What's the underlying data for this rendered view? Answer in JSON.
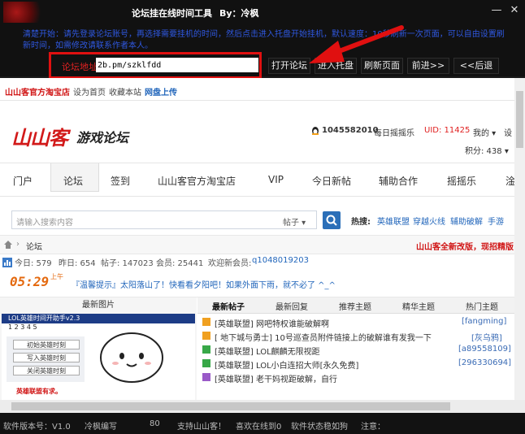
{
  "window": {
    "title": "论坛挂在线时间工具",
    "author": "By：冷枫",
    "min_glyph": "—",
    "close_glyph": "✕"
  },
  "notice": "清楚开始：请先登录论坛账号，再选择需要挂机的时间，然后点击进入托盘开始挂机，默认速度：10秒刷新一次页面，可以自由设置刷新时间，如需修改请联系作者本人。",
  "address": {
    "label": "论坛地址",
    "value": "2b.pm/szklfdd"
  },
  "nav_buttons": {
    "open": "打开论坛",
    "tray": "进入托盘",
    "refresh": "刷新页面",
    "forward": "前进>>",
    "back": "<<后退"
  },
  "site": {
    "topbar": {
      "shop": "山山客官方淘宝店",
      "home": "设为首页",
      "fav": "收藏本站",
      "cloud": "网盘上传"
    },
    "logo_text": "山山客",
    "logo_sub": "游戏论坛",
    "user": {
      "qq": "1045582010",
      "shake": "每日摇摇乐",
      "uid": "UID: 11425",
      "mine": "我的 ▾",
      "settings": "设",
      "points": "积分: 438 ▾"
    },
    "mainnav": [
      "门户",
      "论坛",
      "签到",
      "山山客官方淘宝店",
      "VIP",
      "今日新帖",
      "辅助合作",
      "摇摇乐",
      "淦"
    ],
    "search": {
      "placeholder": "请输入搜索内容",
      "type": "帖子 ▾"
    },
    "hot": {
      "label": "热搜:",
      "items": [
        "英雄联盟",
        "穿越火线",
        "辅助破解",
        "手游"
      ]
    },
    "crumb": "论坛",
    "promo": "山山客全新改版，现招精版",
    "stats": {
      "today": "今日: 579",
      "yesterday": "昨日: 654",
      "posts": "帖子: 147023",
      "members": "会员: 25441",
      "newest_label": "欢迎新会员:",
      "newest": "q1048019203"
    },
    "banner": {
      "clock": "05:29",
      "clock_sub": "上午",
      "text": "『温馨提示』太阳落山了！快看看夕阳吧！如果外面下雨，就不必了 ^_^"
    },
    "leftpanel": {
      "title": "最新图片",
      "widget_title": "LOL英雄时间开助手v2.3",
      "btn1": "初始英雄时刻",
      "btn2": "写入英雄时刻",
      "btn3": "关闭英雄时刻",
      "footer": "英雄联盟有求。"
    },
    "tabs": [
      "最新帖子",
      "最新回复",
      "推荐主题",
      "精华主题",
      "热门主题"
    ],
    "threads": [
      {
        "title": "[英雄联盟] 网吧特权谁能破解啊",
        "user": "[fangming]",
        "icon_color": "#f0a020"
      },
      {
        "title": "[ 地下城与勇士] 10号巡查员附件链接上的破解谁有发我一下",
        "user": "[灰乌鸦]",
        "icon_color": "#f0a020"
      },
      {
        "title": "[英雄联盟] LOL麒麟无限视距",
        "user": "[a89558109]",
        "icon_color": "#38a848"
      },
      {
        "title": "[英雄联盟] LOL小白连招大师[永久免费]",
        "user": "[296330694]",
        "icon_color": "#38a848"
      },
      {
        "title": "[英雄联盟] 老干妈视距破解，自行",
        "user": "",
        "icon_color": "#9a5ac8"
      }
    ]
  },
  "statusbar": {
    "version": "软件版本号：V1.0",
    "author": "冷枫编写",
    "count": "80",
    "support": "支持山山客！",
    "online": "喜欢在线到0",
    "state": "软件状态稳如狗",
    "note": "注意："
  },
  "colors": {
    "accent_red": "#e01010",
    "link_blue": "#2266bb",
    "uid_red": "#e02020",
    "notice_blue": "#2f58e0"
  }
}
